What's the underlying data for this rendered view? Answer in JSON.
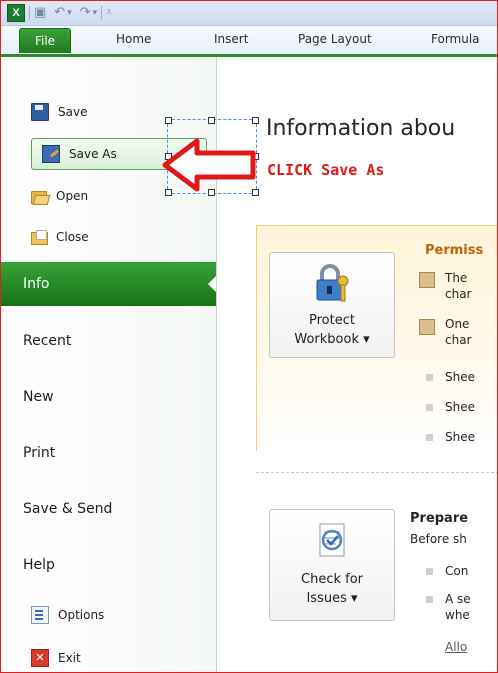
{
  "ribbon": {
    "tabs": [
      "File",
      "Home",
      "Insert",
      "Page Layout",
      "Formula"
    ]
  },
  "backstage": {
    "commands": {
      "save": "Save",
      "save_as": "Save As",
      "open": "Open",
      "close": "Close",
      "options": "Options",
      "exit": "Exit"
    },
    "nav": {
      "info": "Info",
      "recent": "Recent",
      "new": "New",
      "print": "Print",
      "save_send": "Save & Send",
      "help": "Help"
    },
    "exit_icon_glyph": "✕"
  },
  "annotation": {
    "text": "CLICK Save As",
    "color": "#e01818"
  },
  "main": {
    "heading": "Information abou",
    "permissions": {
      "title": "Permiss",
      "button_line1": "Protect",
      "button_line2": "Workbook ▾",
      "lines": [
        "The",
        "char",
        "One",
        "char",
        "Shee",
        "Shee",
        "Shee"
      ]
    },
    "prepare": {
      "title": "Prepare",
      "intro": "Before sh",
      "button_line1": "Check for",
      "button_line2": "Issues ▾",
      "lines": [
        "Con",
        "A se",
        "whe"
      ],
      "link": "Allo"
    }
  },
  "colors": {
    "accent_green": "#2b8c2b",
    "permission_title": "#c0620a",
    "frame_border": "#e02020"
  }
}
